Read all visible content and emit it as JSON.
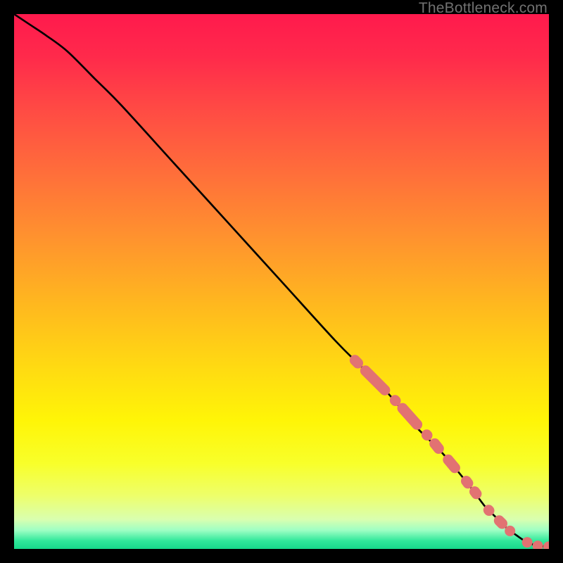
{
  "watermark": "TheBottleneck.com",
  "chart_data": {
    "type": "line",
    "title": "",
    "xlabel": "",
    "ylabel": "",
    "xlim": [
      0,
      100
    ],
    "ylim": [
      0,
      100
    ],
    "series": [
      {
        "name": "curve",
        "x": [
          0,
          3,
          6,
          10,
          15,
          20,
          30,
          40,
          50,
          60,
          65,
          70,
          75,
          80,
          85,
          88,
          90,
          92,
          94,
          96,
          98,
          100
        ],
        "y": [
          100,
          98,
          96,
          93,
          88,
          83,
          72,
          61,
          50,
          39,
          34,
          29,
          23,
          18,
          12,
          8,
          6,
          4,
          2.5,
          1.2,
          0.6,
          0.4
        ]
      }
    ],
    "markers": [
      {
        "x_start": 63,
        "x_end": 65,
        "y_start": 36,
        "y_end": 34
      },
      {
        "x_start": 65,
        "x_end": 70,
        "y_start": 34,
        "y_end": 29
      },
      {
        "x_start": 70.5,
        "x_end": 72,
        "y_start": 28.5,
        "y_end": 27
      },
      {
        "x_start": 72,
        "x_end": 76,
        "y_start": 27,
        "y_end": 22.5
      },
      {
        "x_start": 76.5,
        "x_end": 78,
        "y_start": 22,
        "y_end": 20.5
      },
      {
        "x_start": 78,
        "x_end": 80,
        "y_start": 20.5,
        "y_end": 18
      },
      {
        "x_start": 80.5,
        "x_end": 83,
        "y_start": 17.5,
        "y_end": 14.5
      },
      {
        "x_start": 84,
        "x_end": 85.5,
        "y_start": 13.5,
        "y_end": 11.5
      },
      {
        "x_start": 85.5,
        "x_end": 87,
        "y_start": 11.5,
        "y_end": 9.5
      },
      {
        "x_start": 88,
        "x_end": 89.5,
        "y_start": 8,
        "y_end": 6.5
      },
      {
        "x_start": 90,
        "x_end": 92,
        "y_start": 6,
        "y_end": 4
      },
      {
        "x_start": 92,
        "x_end": 93.5,
        "y_start": 4,
        "y_end": 2.7
      },
      {
        "x_start": 95,
        "x_end": 96,
        "y_start": 1.5,
        "y_end": 1.2
      },
      {
        "x_start": 97,
        "x_end": 97.5,
        "y_start": 0.8,
        "y_end": 0.65
      },
      {
        "x_start": 99,
        "x_end": 100,
        "y_start": 0.45,
        "y_end": 0.4
      }
    ],
    "gradient_stops": [
      {
        "pos": 0.0,
        "color": "#ff1a4d"
      },
      {
        "pos": 0.08,
        "color": "#ff2a4b"
      },
      {
        "pos": 0.18,
        "color": "#ff4b44"
      },
      {
        "pos": 0.3,
        "color": "#ff6f3a"
      },
      {
        "pos": 0.42,
        "color": "#ff932e"
      },
      {
        "pos": 0.54,
        "color": "#ffb71f"
      },
      {
        "pos": 0.66,
        "color": "#ffda12"
      },
      {
        "pos": 0.76,
        "color": "#fff507"
      },
      {
        "pos": 0.84,
        "color": "#f8ff2a"
      },
      {
        "pos": 0.9,
        "color": "#eeff6a"
      },
      {
        "pos": 0.945,
        "color": "#d9ffb0"
      },
      {
        "pos": 0.965,
        "color": "#9effc4"
      },
      {
        "pos": 0.985,
        "color": "#30e89a"
      },
      {
        "pos": 1.0,
        "color": "#17d98a"
      }
    ]
  }
}
